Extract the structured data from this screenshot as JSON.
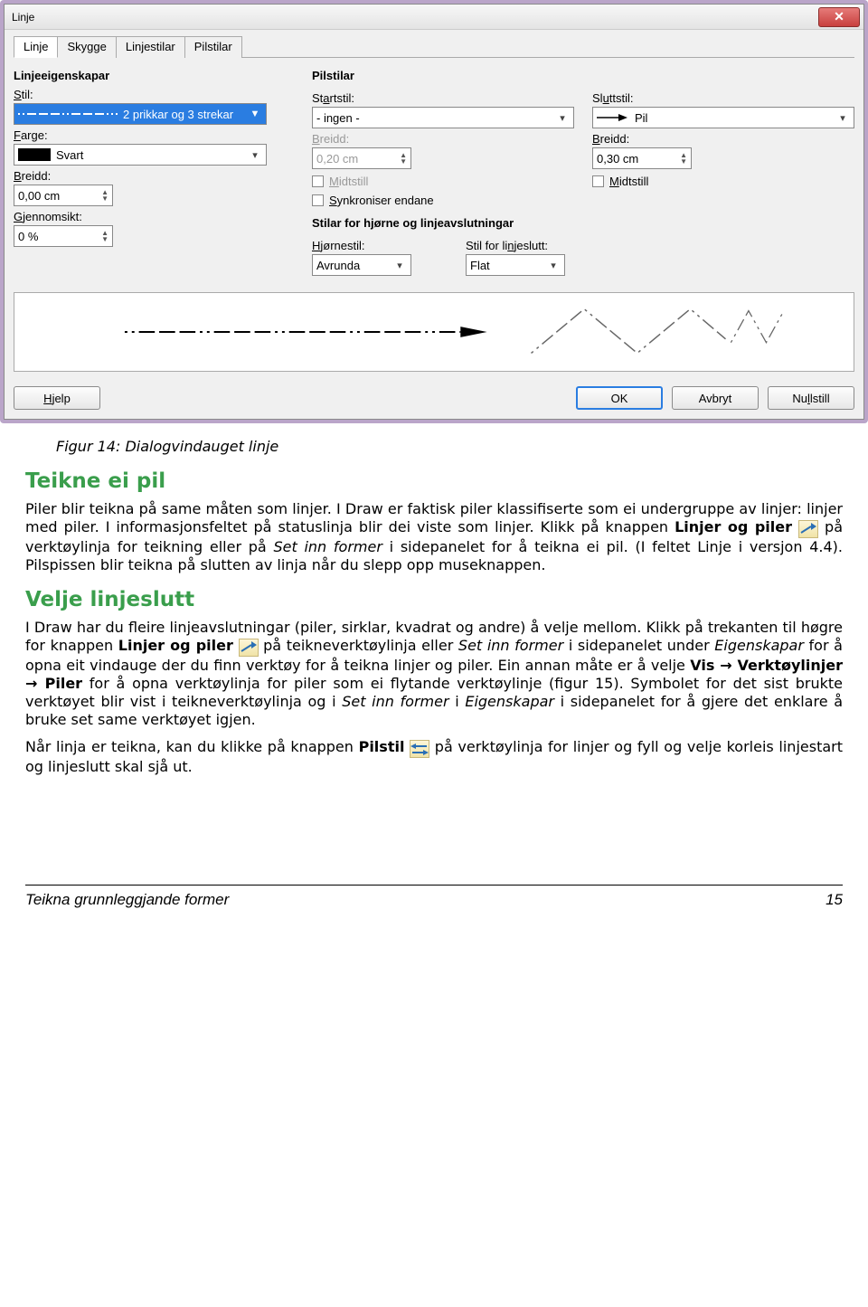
{
  "dialog": {
    "title": "Linje",
    "close": "X",
    "tabs": [
      "Linje",
      "Skygge",
      "Linjestilar",
      "Pilstilar"
    ],
    "active_tab": "Linje",
    "left": {
      "heading": "Linjeeigenskapar",
      "stil_label": "Stil:",
      "stil_value": "2 prikkar og 3 strekar",
      "farge_label": "Farge:",
      "farge_value": "Svart",
      "breidd_label": "Breidd:",
      "breidd_value": "0,00 cm",
      "gjennom_label": "Gjennomsikt:",
      "gjennom_value": "0 %"
    },
    "right": {
      "heading": "Pilstilar",
      "start_label": "Startstil:",
      "start_value": "- ingen -",
      "slutt_label": "Sluttstil:",
      "slutt_value": "Pil",
      "breidd1_label": "Breidd:",
      "breidd1_value": "0,20 cm",
      "breidd2_label": "Breidd:",
      "breidd2_value": "0,30 cm",
      "midtstill1": "Midtstill",
      "midtstill2": "Midtstill",
      "synk": "Synkroniser endane",
      "corner_heading": "Stilar for hjørne og linjeavslutningar",
      "hjorne_label": "Hjørnestil:",
      "hjorne_value": "Avrunda",
      "ende_label": "Stil for linjeslutt:",
      "ende_value": "Flat"
    },
    "buttons": {
      "help": "Hjelp",
      "ok": "OK",
      "cancel": "Avbryt",
      "reset": "Nullstill"
    }
  },
  "doc": {
    "caption": "Figur 14: Dialogvindauget linje",
    "h1": "Teikne ei pil",
    "p1a": "Piler blir teikna på same måten som linjer. I Draw er faktisk piler klassifiserte som ei undergruppe av linjer: linjer med piler. I informasjonsfeltet på statuslinja blir dei viste som linjer. Klikk på knappen ",
    "p1_bold1": "Linjer og piler",
    "p1b": " på verktøylinja for teikning eller på ",
    "p1_it1": "Set inn former",
    "p1c": " i sidepanelet for å teikna ei pil. (I feltet Linje i versjon 4.4). Pilspissen blir teikna på slutten av linja når du slepp opp museknappen.",
    "h2": "Velje linjeslutt",
    "p2a": "I Draw har du fleire linjeavslutningar (piler, sirklar, kvadrat og andre) å velje mellom. Klikk på trekanten til høgre for knappen ",
    "p2_bold1": "Linjer og piler",
    "p2b": " på teikneverktøylinja eller ",
    "p2_it1": "Set inn former",
    "p2c": " i sidepanelet under ",
    "p2_it2": "Eigenskapar",
    "p2d": " for å opna eit vindauge der du finn verktøy for å teikna linjer og piler. Ein annan måte er å velje ",
    "p2_bold2": "Vis → Verktøylinjer → Piler",
    "p2e": " for å opna verktøylinja for piler som ei flytande verktøylinje (figur 15). Symbolet for det sist brukte verktøyet blir vist i teikneverktøylinja og i ",
    "p2_it3": "Set inn former",
    "p2f": " i ",
    "p2_it4": "Eigenskapar",
    "p2g": " i sidepanelet for å gjere det enklare å bruke set same verktøyet igjen.",
    "p3a": "Når linja er teikna, kan du klikke på knappen ",
    "p3_bold1": "Pilstil",
    "p3b": " på verktøylinja for linjer og fyll og velje korleis linjestart og linjeslutt skal sjå ut."
  },
  "footer": {
    "left": "Teikna grunnleggjande former",
    "right": "15"
  }
}
